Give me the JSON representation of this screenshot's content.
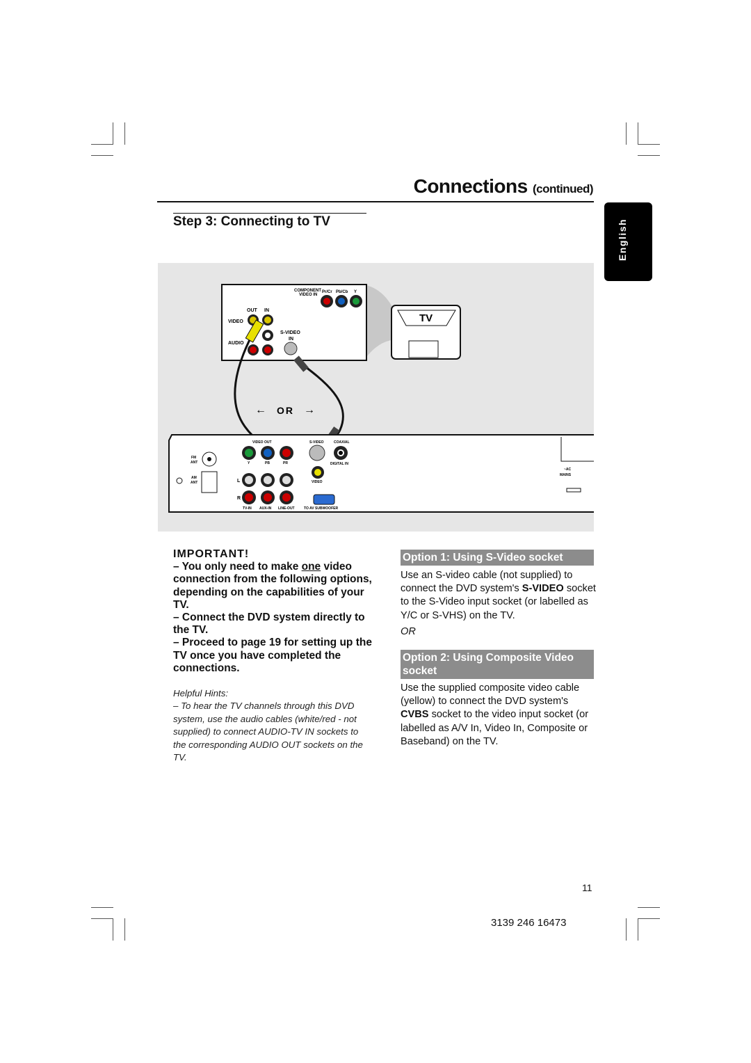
{
  "header": {
    "title": "Connections",
    "title_suffix": "(continued)"
  },
  "language_tab": "English",
  "step_title": "Step 3:  Connecting to TV",
  "diagram": {
    "tv_label": "TV",
    "tv_panel": {
      "component": "COMPONENT",
      "video_in": "VIDEO IN",
      "pr": "Pr/Cr",
      "pb": "Pb/Cb",
      "y": "Y",
      "out": "OUT",
      "in": "IN",
      "video": "VIDEO",
      "audio": "AUDIO",
      "svideo": "S-VIDEO",
      "svideo_in": "IN"
    },
    "or_label": "OR",
    "dvd_panel": {
      "fm": "FM",
      "ant": "ANT",
      "am": "AM",
      "video_out": "VIDEO OUT",
      "y": "Y",
      "pb": "PB",
      "pr": "PR",
      "svideo": "S-VIDEO",
      "coaxial": "COAXIAL",
      "digital_in": "DIGITAL IN",
      "video": "VIDEO",
      "l": "L",
      "r": "R",
      "tv_in": "TV-IN",
      "aux_in": "AUX-IN",
      "line_out": "LINE-OUT",
      "subwoofer": "TO AV SUBWOOFER",
      "ac": "~AC",
      "mains": "MAINS"
    }
  },
  "important": {
    "heading": "IMPORTANT!",
    "line1_pre": "– You only need to make ",
    "line1_em": "one",
    "line1_post": " video connection from the following options, depending on the capabilities of your TV.",
    "line2": "– Connect the DVD system directly to the TV.",
    "line3": "– Proceed to page 19 for setting up the TV once you have completed the connections."
  },
  "hints": {
    "heading": "Helpful Hints:",
    "text": "–  To hear the TV channels through this DVD system, use the audio cables (white/red - not supplied) to connect AUDIO-TV IN sockets to the corresponding AUDIO OUT sockets on the TV."
  },
  "option1": {
    "title": "Option 1: Using S-Video socket",
    "text_pre": "Use an S-video cable (not supplied) to connect the DVD system's ",
    "text_bold": "S-VIDEO",
    "text_post": " socket to the S-Video input socket (or labelled as Y/C or S-VHS) on the TV."
  },
  "or_text": "OR",
  "option2": {
    "title": "Option 2: Using Composite Video socket",
    "text_pre": "Use the supplied composite video cable (yellow) to connect the DVD system's ",
    "text_bold": "CVBS",
    "text_post": " socket to the video input socket (or labelled as A/V In, Video In, Composite or Baseband) on the TV."
  },
  "page_number": "11",
  "doc_code": "3139 246 16473"
}
